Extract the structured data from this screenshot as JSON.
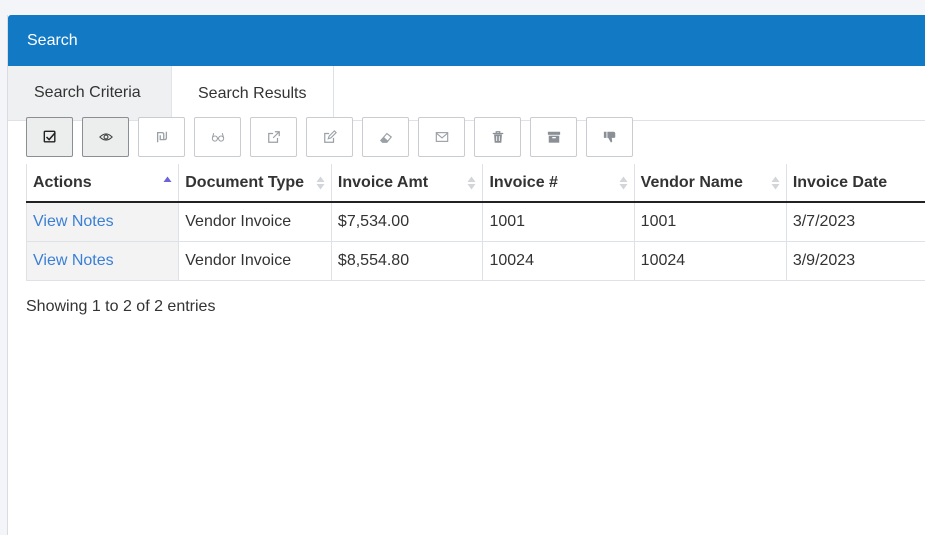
{
  "panel": {
    "title": "Search"
  },
  "tabs": [
    {
      "label": "Search Criteria",
      "active": false
    },
    {
      "label": "Search Results",
      "active": true
    }
  ],
  "toolbar": {
    "buttons": [
      {
        "icon": "check-square-icon",
        "pressed": true
      },
      {
        "icon": "eye-icon",
        "pressed": true
      },
      {
        "icon": "currency-shekel-icon",
        "pressed": false
      },
      {
        "icon": "glasses-icon",
        "pressed": false
      },
      {
        "icon": "external-link-icon",
        "pressed": false
      },
      {
        "icon": "edit-icon",
        "pressed": false
      },
      {
        "icon": "eraser-icon",
        "pressed": false
      },
      {
        "icon": "envelope-icon",
        "pressed": false
      },
      {
        "icon": "trash-icon",
        "pressed": false
      },
      {
        "icon": "archive-icon",
        "pressed": false
      },
      {
        "icon": "thumbs-down-icon",
        "pressed": false
      }
    ]
  },
  "table": {
    "columns": [
      "Actions",
      "Document Type",
      "Invoice Amt",
      "Invoice #",
      "Vendor Name",
      "Invoice Date"
    ],
    "sort": {
      "column": "Actions",
      "direction": "asc"
    },
    "rows": [
      [
        "View Notes",
        "Vendor Invoice",
        "$7,534.00",
        "1001",
        "1001",
        "3/7/2023"
      ],
      [
        "View Notes",
        "Vendor Invoice",
        "$8,554.80",
        "10024",
        "10024",
        "3/9/2023"
      ]
    ]
  },
  "info": "Showing 1 to 2 of 2 entries",
  "colors": {
    "header": "#1279c4",
    "link": "#3a7fd5",
    "sort_active": "#6c63d6"
  }
}
